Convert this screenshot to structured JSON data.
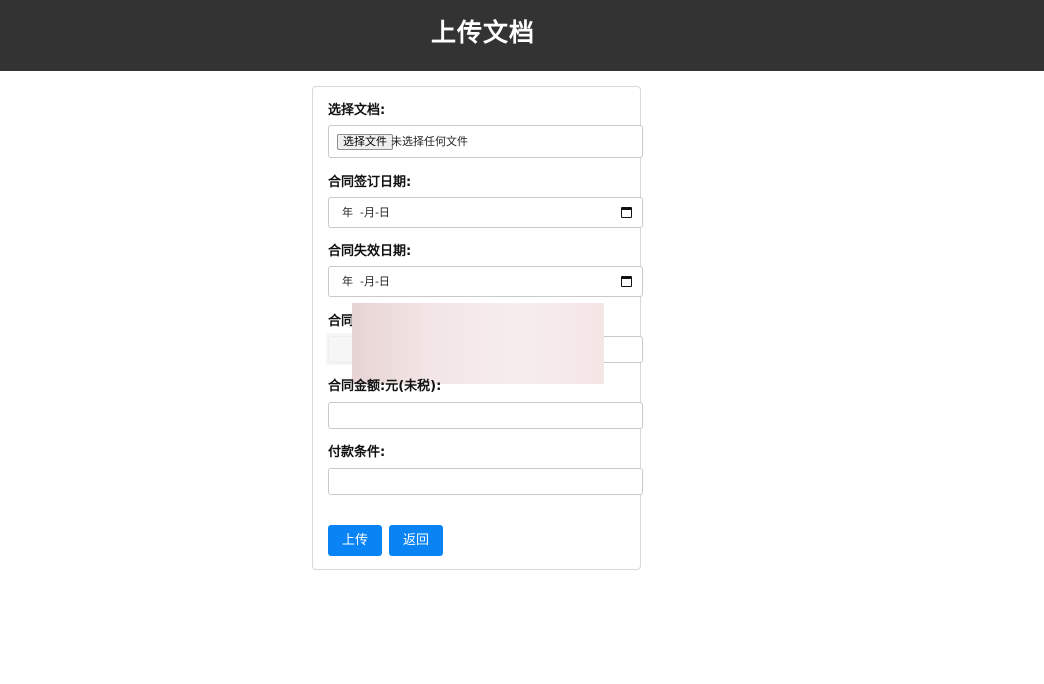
{
  "header": {
    "title": "上传文档"
  },
  "form": {
    "file": {
      "label": "选择文档:",
      "button_label": "选择文件",
      "status": "未选择任何文件"
    },
    "sign_date": {
      "label": "合同签订日期:",
      "value": "年  -月-日"
    },
    "expiry_date": {
      "label": "合同失效日期:",
      "value": "年  -月-日"
    },
    "redacted_field": {
      "label_visible_part": "合同"
    },
    "amount": {
      "label": "合同金额:元(未税):",
      "value": ""
    },
    "payment_terms": {
      "label": "付款条件:",
      "value": ""
    },
    "buttons": {
      "upload_label": "上传",
      "back_label": "返回"
    }
  },
  "colors": {
    "header_bg": "#333333",
    "primary_button": "#0a84f5"
  },
  "icons": {
    "date_picker": "calendar-icon"
  }
}
